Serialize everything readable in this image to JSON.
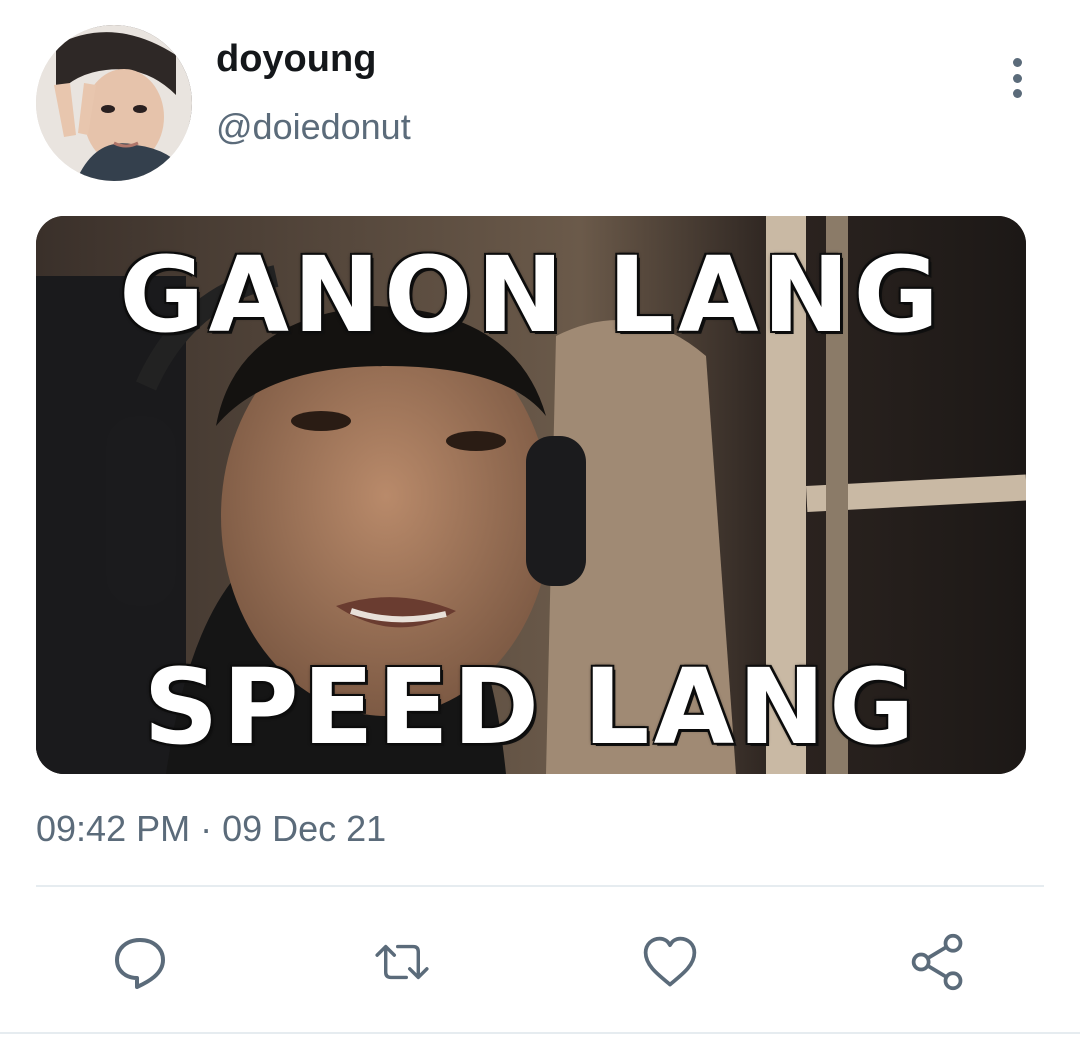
{
  "tweet": {
    "display_name": "doyoung",
    "handle": "@doiedonut",
    "timestamp": "09:42 PM · 09 Dec 21",
    "media": {
      "caption_top": "GANON LANG",
      "caption_bottom": "SPEED LANG"
    }
  },
  "actions": [
    {
      "name": "reply",
      "icon": "reply-icon"
    },
    {
      "name": "retweet",
      "icon": "retweet-icon"
    },
    {
      "name": "like",
      "icon": "heart-icon"
    },
    {
      "name": "share",
      "icon": "share-icon"
    }
  ],
  "colors": {
    "text_primary": "#14171a",
    "text_secondary": "#5b6b7a",
    "divider": "#e6ecf0"
  }
}
